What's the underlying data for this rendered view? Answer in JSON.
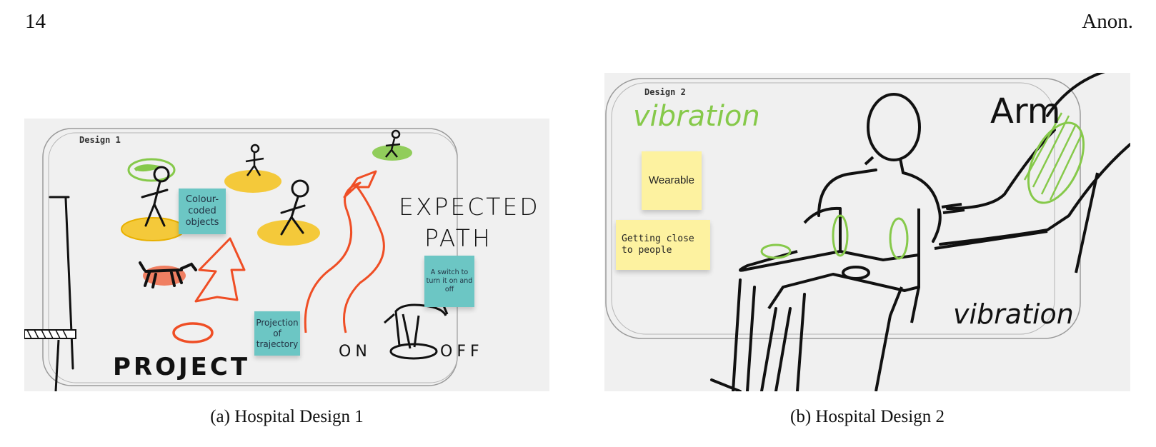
{
  "header": {
    "page_number": "14",
    "author": "Anon."
  },
  "figure_a": {
    "frame_label": "Design 1",
    "sticky_colour": "Colour-\ncoded\nobjects",
    "sticky_projection": "Projection\nof\ntrajectory",
    "sticky_switch": "A switch to\nturn it on and\noff",
    "hand_expected": "EXPECTED",
    "hand_path": "PATH",
    "hand_project": "PROJECT",
    "hand_on": "ON",
    "hand_off": "OFF",
    "caption": "(a) Hospital Design 1"
  },
  "figure_b": {
    "frame_label": "Design 2",
    "hand_vibration_top": "vibration",
    "hand_arm": "Arm",
    "hand_vibration_bottom": "vibration",
    "sticky_wearable": "Wearable",
    "sticky_close": "Getting close\nto people",
    "caption": "(b) Hospital Design 2"
  },
  "colors": {
    "board": "#f0f0f0",
    "teal_sticky": "#6cc6c4",
    "yellow_sticky": "#fdf2a0",
    "marker_red": "#ef4e25",
    "marker_yellow": "#f4c21a",
    "marker_green": "#86c94a",
    "marker_black": "#111111"
  }
}
